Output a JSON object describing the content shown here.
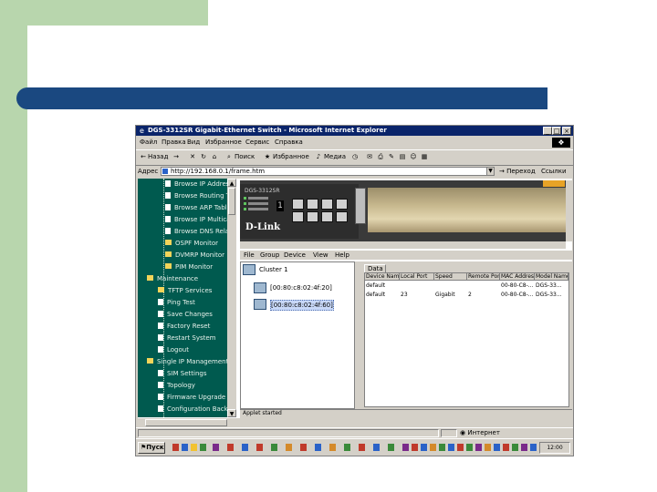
{
  "window": {
    "title": "DGS-3312SR Gigabit-Ethernet Switch - Microsoft Internet Explorer",
    "minimize": "_",
    "maximize": "□",
    "close": "×"
  },
  "menu": {
    "items": [
      "Файл",
      "Правка",
      "Вид",
      "Избранное",
      "Сервис",
      "Справка"
    ]
  },
  "toolbar": {
    "back_label": "Назад",
    "search_label": "Поиск",
    "favorites_label": "Избранное",
    "media_label": "Медиа"
  },
  "address": {
    "label": "Адрес",
    "url": "http://192.168.0.1/frame.htm",
    "go_label": "Переход",
    "links_label": "Ссылки"
  },
  "tree": {
    "items": [
      {
        "label": "Browse IP Address",
        "kind": "doc"
      },
      {
        "label": "Browse Routing Table",
        "kind": "doc"
      },
      {
        "label": "Browse ARP Table",
        "kind": "doc"
      },
      {
        "label": "Browse IP Multicast",
        "kind": "doc"
      },
      {
        "label": "Browse DNS Relay",
        "kind": "doc"
      },
      {
        "label": "OSPF Monitor",
        "kind": "folder"
      },
      {
        "label": "DVMRP Monitor",
        "kind": "folder"
      },
      {
        "label": "PIM Monitor",
        "kind": "folder"
      },
      {
        "label": "Maintenance",
        "kind": "folder"
      },
      {
        "label": "TFTP Services",
        "kind": "folder"
      },
      {
        "label": "Ping Test",
        "kind": "doc"
      },
      {
        "label": "Save Changes",
        "kind": "doc"
      },
      {
        "label": "Factory Reset",
        "kind": "doc"
      },
      {
        "label": "Restart System",
        "kind": "doc"
      },
      {
        "label": "Logout",
        "kind": "doc"
      },
      {
        "label": "Single IP Management",
        "kind": "folder"
      },
      {
        "label": "SIM Settings",
        "kind": "doc"
      },
      {
        "label": "Topology",
        "kind": "doc"
      },
      {
        "label": "Firmware Upgrade",
        "kind": "doc"
      },
      {
        "label": "Configuration Backup",
        "kind": "doc"
      }
    ]
  },
  "device": {
    "model": "DGS-3312SR",
    "port_digit": "1",
    "logo": "D-Link"
  },
  "mgmt_menu": {
    "items": [
      "File",
      "Group",
      "Device",
      "View",
      "Help"
    ]
  },
  "cluster": {
    "root_label": "Cluster 1",
    "nodes": [
      "[00:80:c8:02:4f:20]",
      "[00:80:c8:02:4f:60]"
    ]
  },
  "data_table": {
    "tab_label": "Data",
    "columns": [
      "Device Name",
      "Local Port",
      "Speed",
      "Remote Port",
      "MAC Address",
      "Model Name"
    ],
    "rows": [
      [
        "default",
        "",
        "",
        "",
        "00-80-C8-...",
        "DGS-33..."
      ],
      [
        "default",
        "23",
        "Gigabit",
        "2",
        "00-80-C8-...",
        "DGS-33..."
      ]
    ]
  },
  "status": {
    "applet_text": "Applet started",
    "zone_label": "Интернет"
  },
  "taskbar": {
    "start_label": "Пуск",
    "clock": "12:00"
  }
}
